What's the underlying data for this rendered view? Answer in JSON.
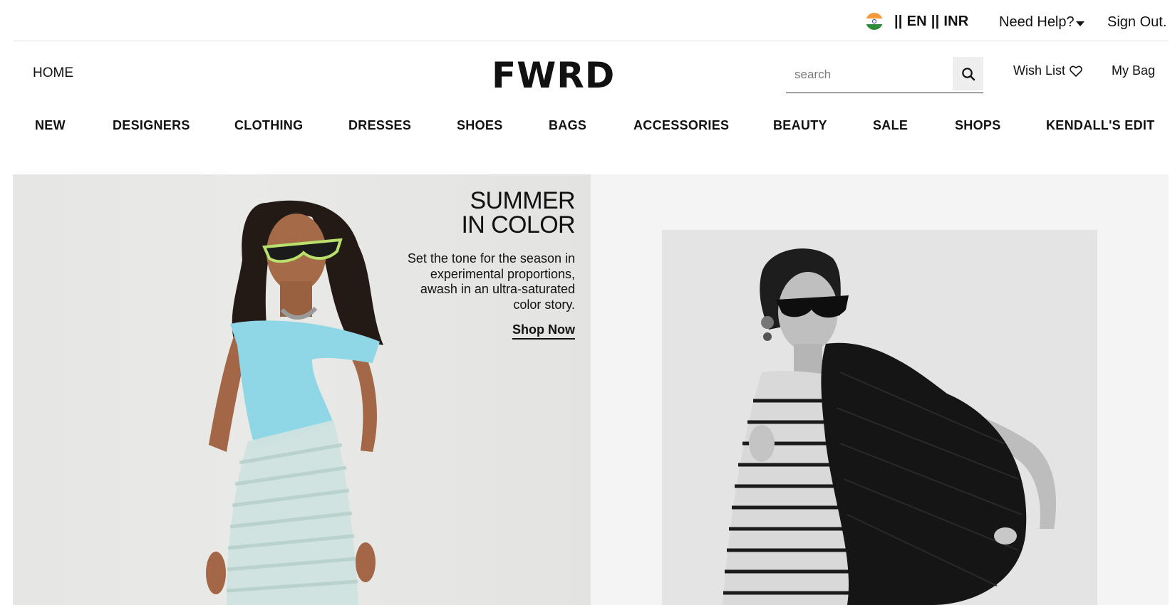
{
  "utility": {
    "flag_icon": "india-flag-icon",
    "separator": "||",
    "language": "EN",
    "currency": "INR",
    "help_label": "Need Help?",
    "signout_label": "Sign Out."
  },
  "header": {
    "home_label": "HOME",
    "logo": "FWRD",
    "search_placeholder": "search",
    "wishlist_label": "Wish List",
    "bag_label": "My Bag"
  },
  "nav": {
    "items": [
      "NEW",
      "DESIGNERS",
      "CLOTHING",
      "DRESSES",
      "SHOES",
      "BAGS",
      "ACCESSORIES",
      "BEAUTY",
      "SALE",
      "SHOPS",
      "KENDALL'S EDIT"
    ]
  },
  "hero": {
    "title_line1": "SUMMER",
    "title_line2": "IN COLOR",
    "body": "Set the tone for the season in experimental proportions, awash in an ultra-saturated color story.",
    "cta": "Shop Now"
  },
  "colors": {
    "text": "#111111",
    "flag_saffron": "#f39a3b",
    "flag_green": "#2f8c3b",
    "top_cyan": "#8fd7e6"
  }
}
